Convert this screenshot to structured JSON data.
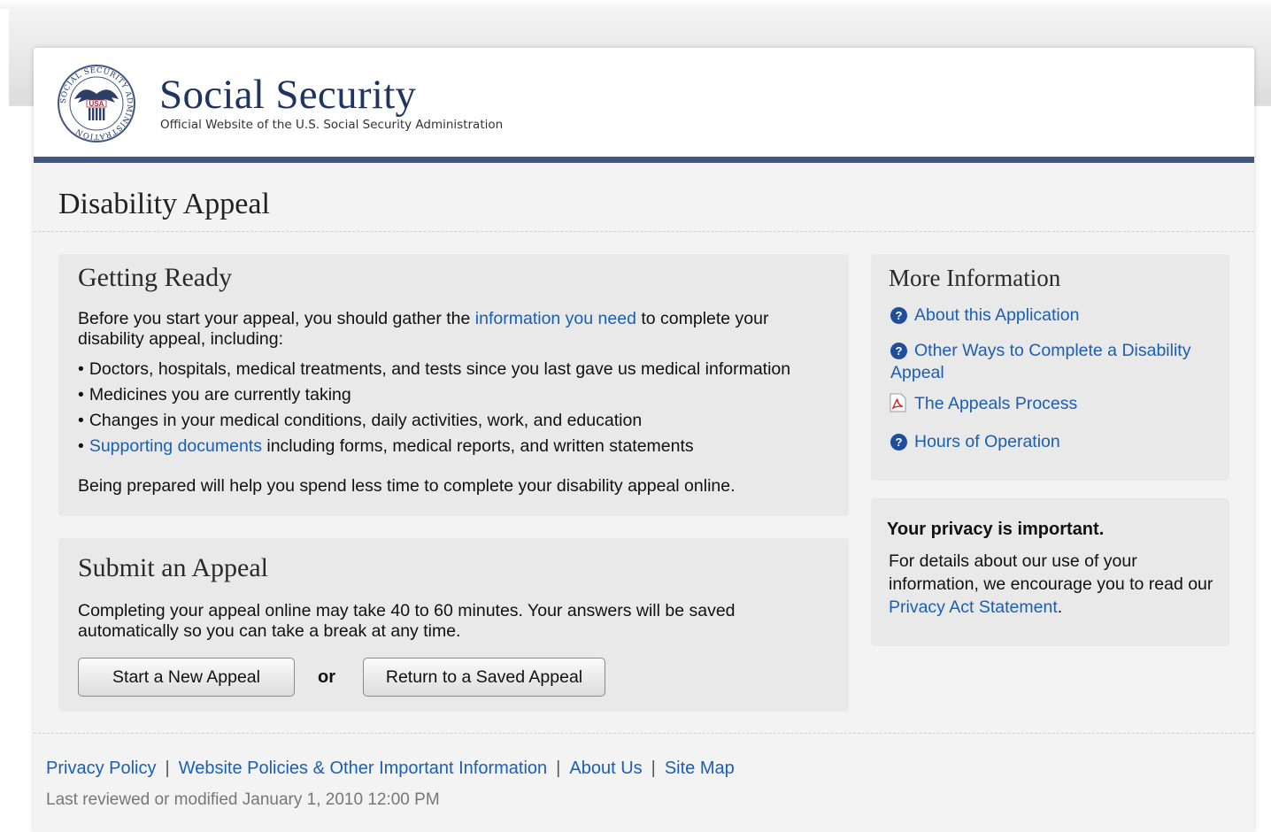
{
  "brand": {
    "title": "Social Security",
    "subtitle": "Official Website of the U.S. Social Security Administration",
    "seal_text": "USA",
    "seal_ring_text": "SOCIAL SECURITY ADMINISTRATION"
  },
  "page_title": "Disability Appeal",
  "getting_ready": {
    "heading": "Getting Ready",
    "intro_before": "Before you start your appeal, you should gather the ",
    "intro_link": "information you need",
    "intro_after": " to complete your disability appeal, including:",
    "bullets": [
      "Doctors, hospitals, medical treatments, and tests since you last gave us medical information",
      "Medicines you are currently taking",
      "Changes in your medical conditions, daily activities, work, and education"
    ],
    "bullet4_link": "Supporting documents",
    "bullet4_rest": " including forms, medical reports, and written statements",
    "closing": "Being prepared will help you spend less time to complete your disability appeal online."
  },
  "submit": {
    "heading": "Submit an Appeal",
    "text": "Completing your appeal online may take 40 to 60 minutes. Your answers will be saved automatically so you can take a break at any time.",
    "start_button": "Start a New Appeal",
    "or_label": "or",
    "return_button": "Return to a Saved Appeal"
  },
  "more_info": {
    "heading": "More Information",
    "links": [
      {
        "label": "About this Application",
        "icon": "help-icon"
      },
      {
        "label": "Other Ways to Complete a Disability Appeal",
        "icon": "help-icon"
      },
      {
        "label": "The Appeals Process",
        "icon": "pdf-icon"
      },
      {
        "label": "Hours of Operation",
        "icon": "help-icon"
      }
    ]
  },
  "privacy": {
    "heading": "Your privacy is important.",
    "text_before": "For details about our use of your information, we encourage you to read our ",
    "link": "Privacy Act Statement",
    "text_after": "."
  },
  "footer": {
    "links": [
      "Privacy Policy",
      "Website Policies & Other Important Information",
      "About Us",
      "Site Map"
    ],
    "separator": "|",
    "last_modified": "Last reviewed or modified January 1, 2010 12:00 PM"
  },
  "colors": {
    "header_rule": "#3f5580",
    "brand_blue": "#1f3560",
    "link": "#1a5fb4",
    "panel": "#e9e9e9",
    "page_bg": "#f3f3f3"
  }
}
